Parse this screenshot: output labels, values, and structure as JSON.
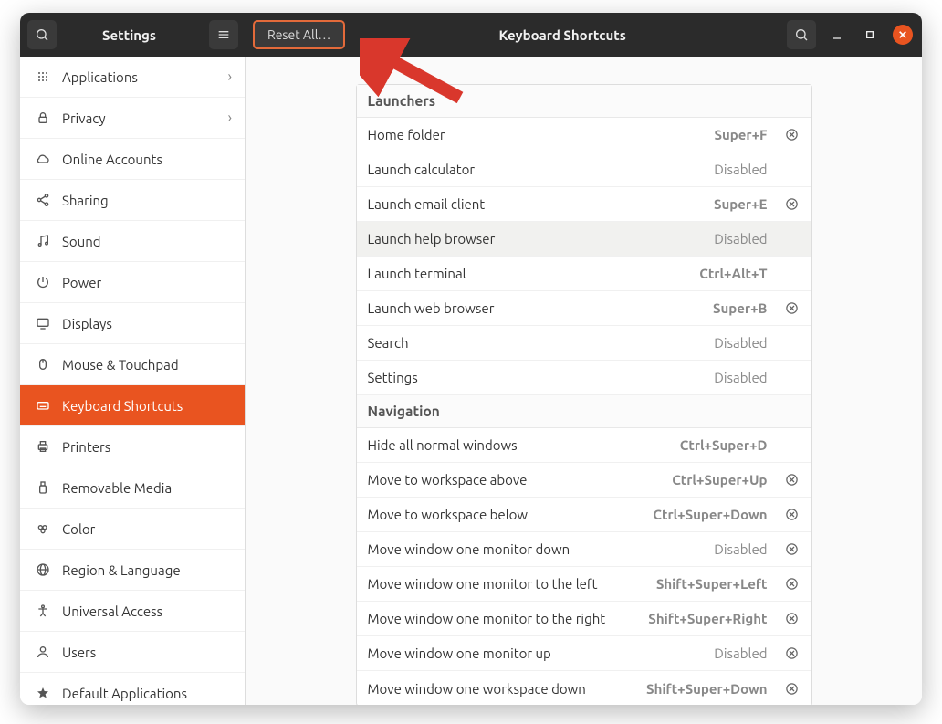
{
  "titlebar": {
    "left_title": "Settings",
    "reset_label": "Reset All…",
    "right_title": "Keyboard Shortcuts"
  },
  "sidebar": {
    "items": [
      {
        "icon": "grid",
        "label": "Applications",
        "chevron": true
      },
      {
        "icon": "lock",
        "label": "Privacy",
        "chevron": true
      },
      {
        "icon": "cloud",
        "label": "Online Accounts"
      },
      {
        "icon": "share",
        "label": "Sharing"
      },
      {
        "icon": "music",
        "label": "Sound"
      },
      {
        "icon": "power",
        "label": "Power"
      },
      {
        "icon": "display",
        "label": "Displays"
      },
      {
        "icon": "mouse",
        "label": "Mouse & Touchpad"
      },
      {
        "icon": "keyboard",
        "label": "Keyboard Shortcuts",
        "selected": true
      },
      {
        "icon": "printer",
        "label": "Printers"
      },
      {
        "icon": "usb",
        "label": "Removable Media"
      },
      {
        "icon": "palette",
        "label": "Color"
      },
      {
        "icon": "globe",
        "label": "Region & Language"
      },
      {
        "icon": "accessibility",
        "label": "Universal Access"
      },
      {
        "icon": "user",
        "label": "Users"
      },
      {
        "icon": "star",
        "label": "Default Applications"
      }
    ]
  },
  "shortcuts": {
    "sections": [
      {
        "title": "Launchers",
        "rows": [
          {
            "label": "Home folder",
            "accel": "Super+F",
            "clear": true
          },
          {
            "label": "Launch calculator",
            "accel": "Disabled",
            "clear": false
          },
          {
            "label": "Launch email client",
            "accel": "Super+E",
            "clear": true
          },
          {
            "label": "Launch help browser",
            "accel": "Disabled",
            "clear": false,
            "highlight": true
          },
          {
            "label": "Launch terminal",
            "accel": "Ctrl+Alt+T",
            "clear": false
          },
          {
            "label": "Launch web browser",
            "accel": "Super+B",
            "clear": true
          },
          {
            "label": "Search",
            "accel": "Disabled",
            "clear": false
          },
          {
            "label": "Settings",
            "accel": "Disabled",
            "clear": false
          }
        ]
      },
      {
        "title": "Navigation",
        "rows": [
          {
            "label": "Hide all normal windows",
            "accel": "Ctrl+Super+D",
            "clear": false
          },
          {
            "label": "Move to workspace above",
            "accel": "Ctrl+Super+Up",
            "clear": true
          },
          {
            "label": "Move to workspace below",
            "accel": "Ctrl+Super+Down",
            "clear": true
          },
          {
            "label": "Move window one monitor down",
            "accel": "Disabled",
            "clear": true
          },
          {
            "label": "Move window one monitor to the left",
            "accel": "Shift+Super+Left",
            "clear": true
          },
          {
            "label": "Move window one monitor to the right",
            "accel": "Shift+Super+Right",
            "clear": true
          },
          {
            "label": "Move window one monitor up",
            "accel": "Disabled",
            "clear": true
          },
          {
            "label": "Move window one workspace down",
            "accel": "Shift+Super+Down",
            "clear": true
          }
        ]
      }
    ]
  }
}
